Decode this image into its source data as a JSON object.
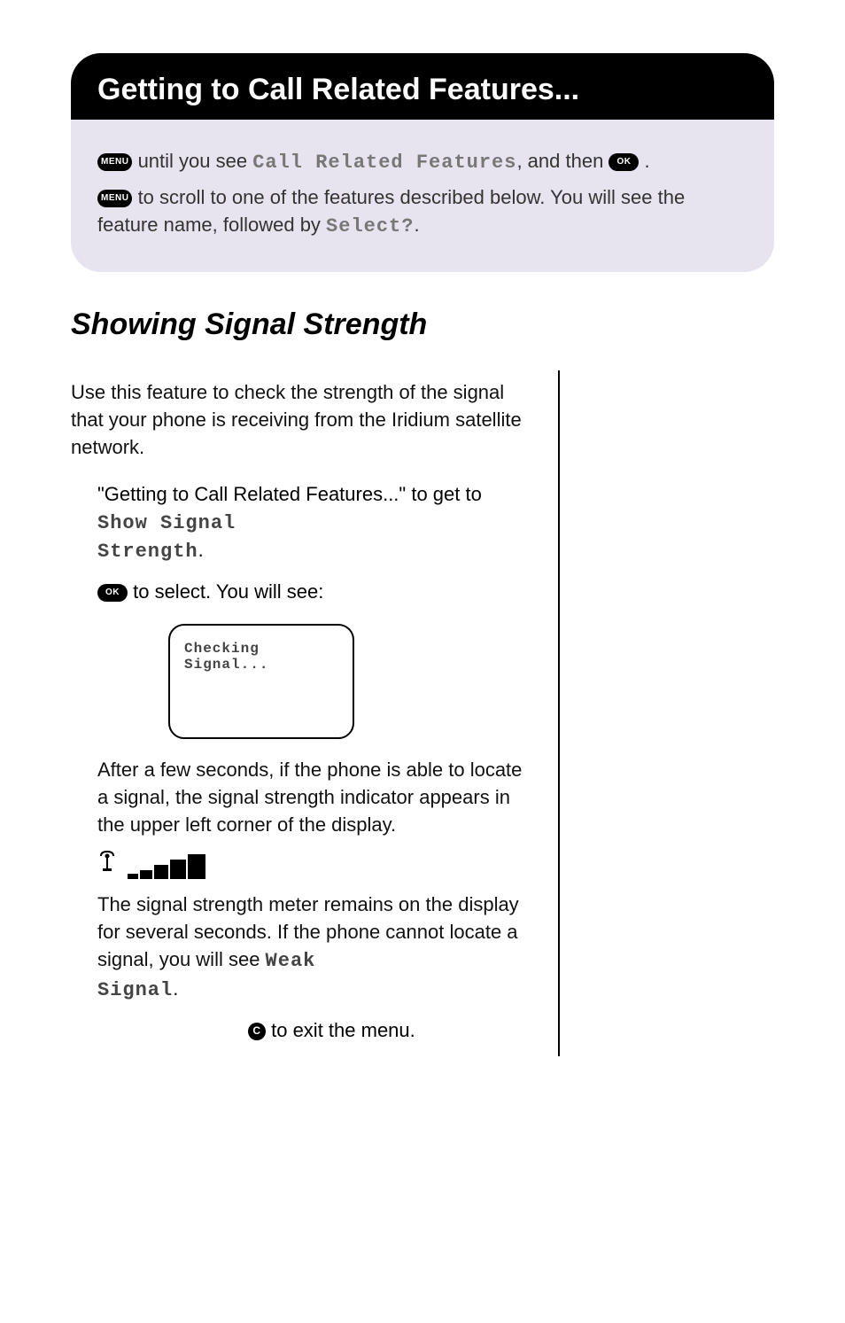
{
  "banner": {
    "title": "Getting to Call Related Features..."
  },
  "note": {
    "line1_pre": "",
    "menu_label": "MENU",
    "line1_mid": " until you see ",
    "line1_lcd": "Call Related Features",
    "line1_post": ", and then ",
    "ok_label": "OK",
    "line1_end": " .",
    "line2_pre": "",
    "line2_mid": " to scroll to one of the features described below. You will see the feature name, followed by ",
    "line2_lcd": "Select?",
    "line2_end": "."
  },
  "section_title": "Showing Signal Strength",
  "intro": "Use this feature to check the strength of the signal that your phone is receiving from the Iridium satellite network.",
  "step1": {
    "pre": "\"Getting to Call Related Features...\" to get to ",
    "lcd1": "Show Signal",
    "lcd2": "Strength",
    "end": "."
  },
  "step2": {
    "text": " to select. You will see:"
  },
  "screen": {
    "line1": "Checking",
    "line2": "Signal..."
  },
  "para1": "After a few seconds, if the phone is able to locate a signal, the signal strength indicator appears in the upper left corner of the display.",
  "para2_pre": "The signal strength meter remains on the display for several seconds. If the phone cannot locate a signal, you will see ",
  "para2_lcd1": "Weak",
  "para2_lcd2": "Signal",
  "para2_end": ".",
  "step3": {
    "c_label": "C",
    "text": " to exit the menu."
  }
}
